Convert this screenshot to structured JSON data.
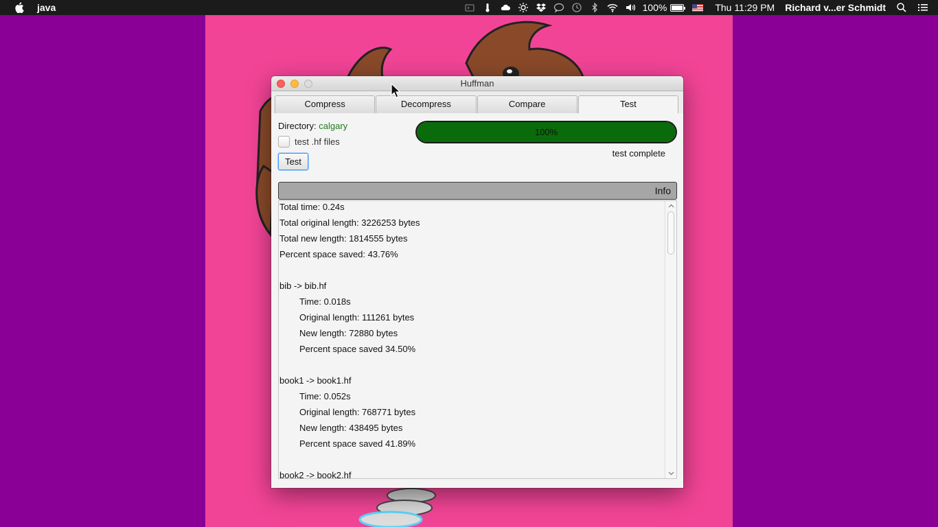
{
  "menubar": {
    "app_name": "java",
    "battery_percent": "100%",
    "clock": "Thu 11:29 PM",
    "user": "Richard v...er Schmidt",
    "icons": [
      "apple-icon",
      "ssh-icon",
      "thermometer-icon",
      "cloud-icon",
      "brightness-icon",
      "dropbox-icon",
      "chat-icon",
      "time-machine-icon",
      "bluetooth-icon",
      "wifi-icon",
      "volume-icon",
      "battery-icon",
      "us-flag-icon",
      "search-icon",
      "list-icon"
    ]
  },
  "window": {
    "title": "Huffman",
    "tabs": [
      {
        "label": "Compress"
      },
      {
        "label": "Decompress"
      },
      {
        "label": "Compare"
      },
      {
        "label": "Test"
      }
    ],
    "active_tab": "Test",
    "directory_label": "Directory:",
    "directory_value": "calgary",
    "checkbox_label": "test .hf files",
    "checkbox_checked": false,
    "test_button": "Test",
    "progress_fraction": 1.0,
    "progress_label": "100%",
    "status": "test complete",
    "info_header": "Info",
    "colors": {
      "directory": "#1c7a1c",
      "progress_fill": "#0a6b0a",
      "desktop": "#8a0096",
      "wallpaper": "#f24496"
    },
    "log": [
      {
        "text": "Total time: 0.24s",
        "indent": false
      },
      {
        "text": "Total original length: 3226253 bytes",
        "indent": false
      },
      {
        "text": "Total new length: 1814555 bytes",
        "indent": false
      },
      {
        "text": "Percent space saved: 43.76%",
        "indent": false
      },
      {
        "text": "",
        "indent": false
      },
      {
        "text": "bib -> bib.hf",
        "indent": false
      },
      {
        "text": "Time: 0.018s",
        "indent": true
      },
      {
        "text": "Original length: 111261 bytes",
        "indent": true
      },
      {
        "text": "New length: 72880 bytes",
        "indent": true
      },
      {
        "text": "Percent space saved 34.50%",
        "indent": true
      },
      {
        "text": "",
        "indent": false
      },
      {
        "text": "book1 -> book1.hf",
        "indent": false
      },
      {
        "text": "Time: 0.052s",
        "indent": true
      },
      {
        "text": "Original length: 768771 bytes",
        "indent": true
      },
      {
        "text": "New length: 438495 bytes",
        "indent": true
      },
      {
        "text": "Percent space saved 41.89%",
        "indent": true
      },
      {
        "text": "",
        "indent": false
      },
      {
        "text": "book2 -> book2.hf",
        "indent": false
      }
    ]
  }
}
